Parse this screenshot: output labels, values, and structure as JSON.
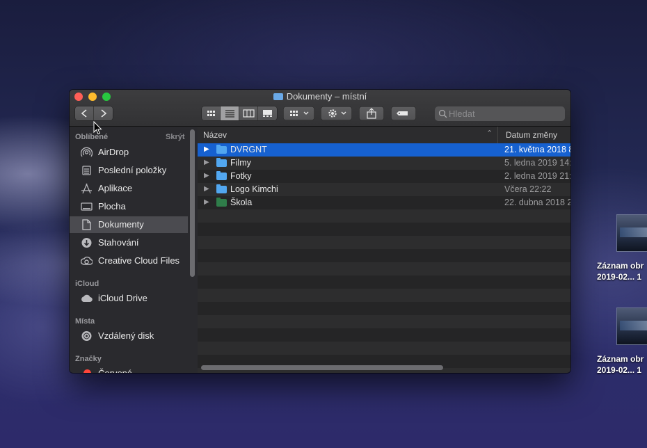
{
  "window": {
    "title": "Dokumenty – místní"
  },
  "toolbar": {
    "back_icon": "chevron-left",
    "forward_icon": "chevron-right",
    "view_modes": [
      "icon-view",
      "list-view",
      "column-view",
      "gallery-view"
    ],
    "active_view": "list-view",
    "group_icon": "grid-dropdown",
    "action_icon": "gear-dropdown",
    "share_icon": "share",
    "tag_icon": "tag",
    "search_placeholder": "Hledat"
  },
  "sidebar": {
    "favorites_header": "Oblíbené",
    "hide_label": "Skrýt",
    "favorites": [
      {
        "label": "AirDrop",
        "icon": "airdrop-icon"
      },
      {
        "label": "Poslední položky",
        "icon": "recents-icon"
      },
      {
        "label": "Aplikace",
        "icon": "applications-icon"
      },
      {
        "label": "Plocha",
        "icon": "desktop-icon"
      },
      {
        "label": "Dokumenty",
        "icon": "documents-icon",
        "selected": true
      },
      {
        "label": "Stahování",
        "icon": "downloads-icon"
      },
      {
        "label": "Creative Cloud Files",
        "icon": "creative-cloud-icon"
      }
    ],
    "icloud_header": "iCloud",
    "icloud": [
      {
        "label": "iCloud Drive",
        "icon": "cloud-icon"
      }
    ],
    "places_header": "Místa",
    "places": [
      {
        "label": "Vzdálený disk",
        "icon": "disk-icon"
      }
    ],
    "tags_header": "Značky",
    "tags": [
      {
        "label": "Červená",
        "color": "#ff453a"
      }
    ]
  },
  "list": {
    "col_name": "Název",
    "col_date": "Datum změny",
    "rows": [
      {
        "name": "DVRGNT",
        "date": "21. května 2018 8",
        "color": "#52a7f0",
        "selected": true
      },
      {
        "name": "Filmy",
        "date": "5. ledna 2019 14:",
        "color": "#52a7f0"
      },
      {
        "name": "Fotky",
        "date": "2. ledna 2019 21:",
        "color": "#52a7f0"
      },
      {
        "name": "Logo Kimchi",
        "date": "Včera 22:22",
        "color": "#52a7f0"
      },
      {
        "name": "Škola",
        "date": "22. dubna 2018 2",
        "color": "#2f7d4a"
      }
    ]
  },
  "desktop_files": [
    {
      "line1": "Záznam obr",
      "line2": "2019-02... 1"
    },
    {
      "line1": "Záznam obr",
      "line2": "2019-02... 1"
    }
  ]
}
